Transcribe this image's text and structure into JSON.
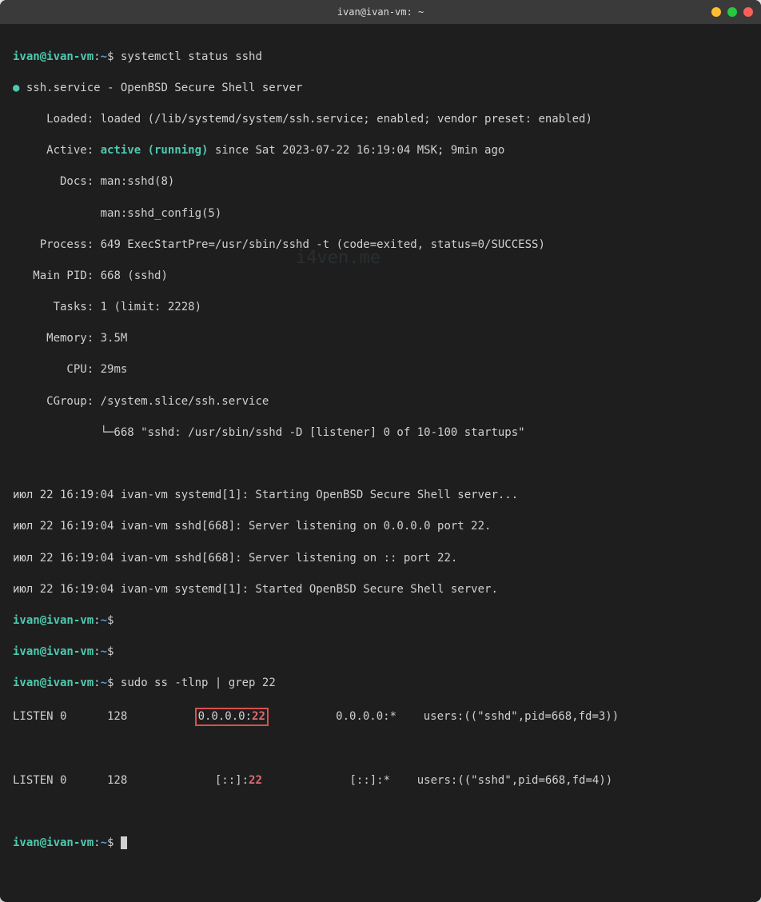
{
  "window": {
    "title": "ivan@ivan-vm: ~"
  },
  "prompt": {
    "user_host": "ivan@ivan-vm",
    "sep": ":",
    "path": "~",
    "dollar": "$"
  },
  "commands": {
    "cmd1": "systemctl status sshd",
    "cmd2": "sudo ss -tlnp | grep 22"
  },
  "status": {
    "service_line": "ssh.service - OpenBSD Secure Shell server",
    "loaded_label": "     Loaded:",
    "loaded_value": " loaded (/lib/systemd/system/ssh.service; enabled; vendor preset: enabled)",
    "active_label": "     Active: ",
    "active_value": "active (running)",
    "active_since": " since Sat 2023-07-22 16:19:04 MSK; 9min ago",
    "docs_label": "       Docs:",
    "docs1": " man:sshd(8)",
    "docs2": "             man:sshd_config(5)",
    "process_label": "    Process:",
    "process_value": " 649 ExecStartPre=/usr/sbin/sshd -t (code=exited, status=0/SUCCESS)",
    "mainpid_label": "   Main PID:",
    "mainpid_value": " 668 (sshd)",
    "tasks_label": "      Tasks:",
    "tasks_value": " 1 (limit: 2228)",
    "memory_label": "     Memory:",
    "memory_value": " 3.5M",
    "cpu_label": "        CPU:",
    "cpu_value": " 29ms",
    "cgroup_label": "     CGroup:",
    "cgroup_value": " /system.slice/ssh.service",
    "cgroup_child": "             └─668 \"sshd: /usr/sbin/sshd -D [listener] 0 of 10-100 startups\""
  },
  "logs": {
    "l1": "июл 22 16:19:04 ivan-vm systemd[1]: Starting OpenBSD Secure Shell server...",
    "l2": "июл 22 16:19:04 ivan-vm sshd[668]: Server listening on 0.0.0.0 port 22.",
    "l3": "июл 22 16:19:04 ivan-vm sshd[668]: Server listening on :: port 22.",
    "l4": "июл 22 16:19:04 ivan-vm systemd[1]: Started OpenBSD Secure Shell server."
  },
  "ss": {
    "row1_a": "LISTEN 0      128          ",
    "row1_addr": "0.0.0.0:",
    "row1_port": "22",
    "row1_b": "          0.0.0.0:*    users:((\"sshd\",pid=668,fd=3))",
    "row2_a": "LISTEN 0      128             ",
    "row2_addr": "[::]:",
    "row2_port": "22",
    "row2_b": "             [::]:*    users:((\"sshd\",pid=668,fd=4))"
  },
  "watermark": "i4ven.me"
}
